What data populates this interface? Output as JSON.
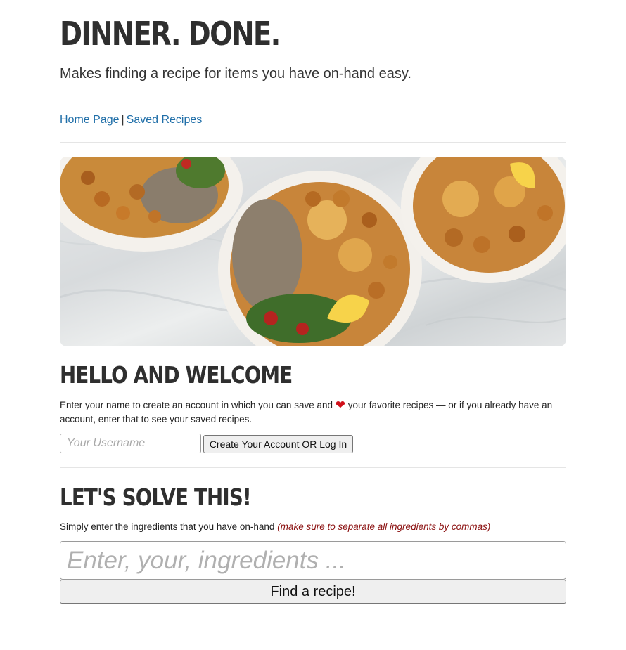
{
  "header": {
    "title": "DINNER. DONE.",
    "tagline": "Makes finding a recipe for items you have on-hand easy."
  },
  "nav": {
    "home_label": "Home Page",
    "separator": "|",
    "saved_label": "Saved Recipes"
  },
  "welcome": {
    "heading": "Hello and Welcome",
    "text_before_heart": "Enter your name to create an account in which you can save and",
    "heart": "❤",
    "text_after_heart": " your favorite recipes — or if you already have an account, enter that to see your saved recipes.",
    "username_placeholder": "Your Username",
    "username_value": "",
    "login_button": "Create Your Account OR Log In"
  },
  "solve": {
    "heading": "Let's solve this!",
    "text": "Simply enter the ingredients that you have on-hand",
    "note": "(make sure to separate all ingredients by commas)",
    "ingredients_placeholder": "Enter, your, ingredients ...",
    "ingredients_value": "",
    "find_button": "Find a recipe!"
  },
  "colors": {
    "link": "#1f6ea8",
    "note": "#8b1010",
    "heart": "#d0101a",
    "heading": "#2f2f2f"
  }
}
